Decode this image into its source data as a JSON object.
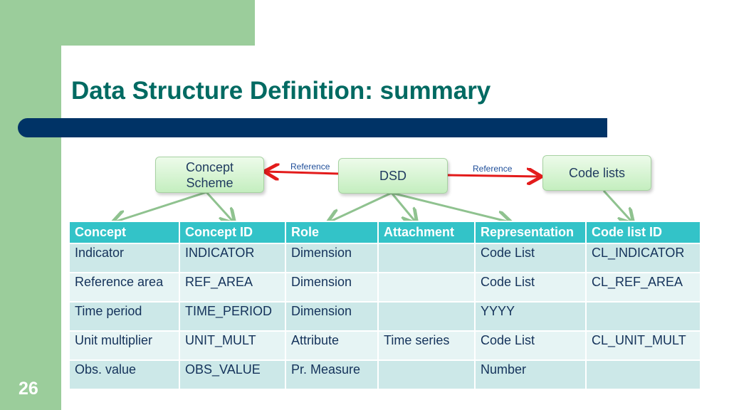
{
  "slide": {
    "title": "Data Structure Definition: summary",
    "page_number": "26"
  },
  "diagram": {
    "boxes": {
      "concept_scheme_line1": "Concept",
      "concept_scheme_line2": "Scheme",
      "dsd": "DSD",
      "code_lists": "Code lists"
    },
    "reference_left": "Reference",
    "reference_right": "Reference",
    "colors": {
      "reference_arrow": "#e31b1b",
      "mapping_arrow": "#8fc28f"
    }
  },
  "table": {
    "headers": [
      "Concept",
      "Concept ID",
      "Role",
      "Attachment",
      "Representation",
      "Code list ID"
    ],
    "rows": [
      [
        "Indicator",
        "INDICATOR",
        "Dimension",
        "",
        "Code List",
        "CL_INDICATOR"
      ],
      [
        "Reference area",
        "REF_AREA",
        "Dimension",
        "",
        "Code List",
        "CL_REF_AREA"
      ],
      [
        "Time period",
        "TIME_PERIOD",
        "Dimension",
        "",
        "YYYY",
        ""
      ],
      [
        "Unit multiplier",
        "UNIT_MULT",
        "Attribute",
        "Time series",
        "Code List",
        "CL_UNIT_MULT"
      ],
      [
        "Obs. value",
        "OBS_VALUE",
        "Pr. Measure",
        "",
        "Number",
        ""
      ]
    ]
  }
}
